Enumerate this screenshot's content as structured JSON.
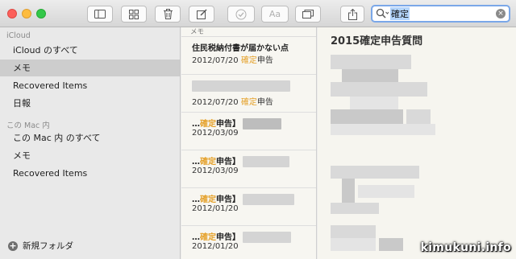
{
  "toolbar": {
    "icons": [
      "sidebar-toggle-icon",
      "grid-icon",
      "trash-icon",
      "compose-icon",
      "checkmark-icon",
      "font-aa-icon",
      "window-icon",
      "share-icon"
    ],
    "aa_label": "Aa",
    "search": {
      "query": "確定",
      "clear": "×"
    }
  },
  "sidebar": {
    "sections": [
      {
        "header": "iCloud",
        "items": [
          {
            "label": "iCloud のすべて"
          },
          {
            "label": "メモ",
            "selected": true
          },
          {
            "label": "Recovered Items"
          },
          {
            "label": "日報"
          }
        ]
      },
      {
        "header": "この Mac 内",
        "items": [
          {
            "label": "この Mac 内 のすべて"
          },
          {
            "label": "メモ"
          },
          {
            "label": "Recovered Items"
          }
        ]
      }
    ],
    "new_folder": "新規フォルダ",
    "new_folder_symbol": "+"
  },
  "notes_list": {
    "header": "メモ",
    "notes": [
      {
        "title": "住民税納付書が届かない点",
        "date": "2012/07/20",
        "snippet_hl": "確定",
        "snippet_rest": "申告"
      },
      {
        "title": "",
        "date": "2012/07/20",
        "snippet_hl": "確定",
        "snippet_rest": "申告"
      },
      {
        "title_prefix": "…",
        "title_hl": "確定",
        "title_rest": "申告】",
        "date": "2012/03/09"
      },
      {
        "title_prefix": "…",
        "title_hl": "確定",
        "title_rest": "申告】",
        "date": "2012/03/09"
      },
      {
        "title_prefix": "…",
        "title_hl": "確定",
        "title_rest": "申告】",
        "date": "2012/01/20"
      },
      {
        "title_prefix": "…",
        "title_hl": "確定",
        "title_rest": "申告】",
        "date": "2012/01/20"
      }
    ]
  },
  "note_content": {
    "title": "2015確定申告質問"
  },
  "watermark": "kimukuni.info",
  "colors": {
    "highlight": "#e5a12a",
    "selection": "#cdcdcd",
    "search_focus": "#7aa7e8"
  }
}
